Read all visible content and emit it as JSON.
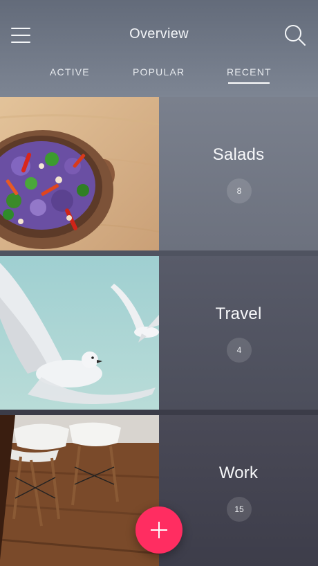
{
  "header": {
    "title": "Overview",
    "menu_icon": "hamburger-menu-icon",
    "search_icon": "search-icon"
  },
  "tabs": [
    {
      "label": "ACTIVE",
      "selected": false
    },
    {
      "label": "POPULAR",
      "selected": false
    },
    {
      "label": "RECENT",
      "selected": true
    }
  ],
  "categories": [
    {
      "name": "Salads",
      "count": "8",
      "image": "salad-bowl-photo"
    },
    {
      "name": "Travel",
      "count": "4",
      "image": "seagulls-photo"
    },
    {
      "name": "Work",
      "count": "15",
      "image": "office-chairs-photo"
    }
  ],
  "fab": {
    "icon": "plus-icon"
  },
  "colors": {
    "accent": "#ff2d61",
    "text": "#f4f6f8"
  }
}
